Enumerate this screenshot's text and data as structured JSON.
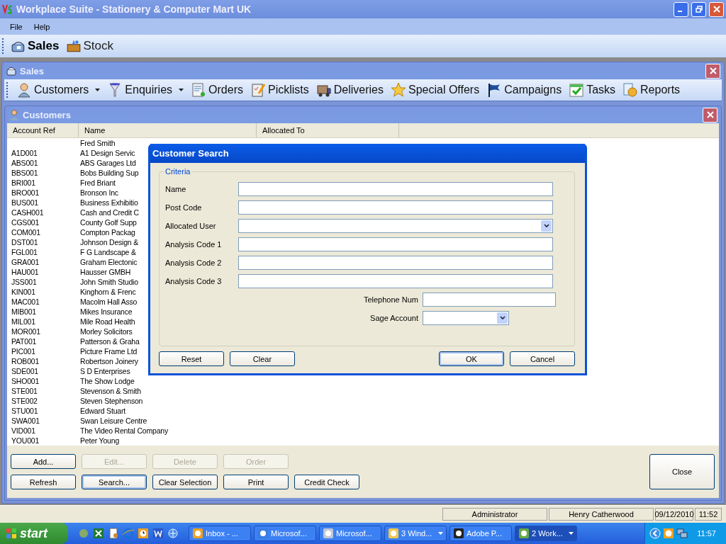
{
  "window": {
    "title": "Workplace Suite - Stationery & Computer Mart UK"
  },
  "menu": [
    "File",
    "Help"
  ],
  "modules": [
    {
      "label": "Sales",
      "selected": true
    },
    {
      "label": "Stock",
      "selected": false
    }
  ],
  "sales_window": {
    "title": "Sales",
    "toolbar": [
      {
        "label": "Customers",
        "dropdown": true
      },
      {
        "label": "Enquiries",
        "dropdown": true
      },
      {
        "label": "Orders",
        "dropdown": false
      },
      {
        "label": "Picklists",
        "dropdown": false
      },
      {
        "label": "Deliveries",
        "dropdown": false
      },
      {
        "label": "Special Offers",
        "dropdown": false
      },
      {
        "label": "Campaigns",
        "dropdown": false
      },
      {
        "label": "Tasks",
        "dropdown": false
      },
      {
        "label": "Reports",
        "dropdown": false
      }
    ]
  },
  "customers_window": {
    "title": "Customers",
    "columns": [
      "Account Ref",
      "Name",
      "Allocated To"
    ],
    "rows": [
      {
        "ref": "",
        "name": "Fred Smith"
      },
      {
        "ref": "A1D001",
        "name": "A1 Design Servic"
      },
      {
        "ref": "ABS001",
        "name": "ABS Garages Ltd"
      },
      {
        "ref": "BBS001",
        "name": "Bobs Building Sup"
      },
      {
        "ref": "BRI001",
        "name": "Fred Briant"
      },
      {
        "ref": "BRO001",
        "name": "Bronson Inc"
      },
      {
        "ref": "BUS001",
        "name": "Business Exhibitio"
      },
      {
        "ref": "CASH001",
        "name": "Cash and Credit C"
      },
      {
        "ref": "CGS001",
        "name": "County Golf Supp"
      },
      {
        "ref": "COM001",
        "name": "Compton Packag"
      },
      {
        "ref": "DST001",
        "name": "Johnson Design &"
      },
      {
        "ref": "FGL001",
        "name": "F G Landscape &"
      },
      {
        "ref": "GRA001",
        "name": "Graham Electonic"
      },
      {
        "ref": "HAU001",
        "name": "Hausser GMBH"
      },
      {
        "ref": "JSS001",
        "name": "John Smith Studio"
      },
      {
        "ref": "KIN001",
        "name": "Kinghorn & Frenc"
      },
      {
        "ref": "MAC001",
        "name": "Macolm Hall Asso"
      },
      {
        "ref": "MIB001",
        "name": "Mikes Insurance"
      },
      {
        "ref": "MIL001",
        "name": "Mile Road Health"
      },
      {
        "ref": "MOR001",
        "name": "Morley Solicitors"
      },
      {
        "ref": "PAT001",
        "name": "Patterson & Graha"
      },
      {
        "ref": "PIC001",
        "name": "Picture Frame Ltd"
      },
      {
        "ref": "ROB001",
        "name": "Robertson Joinery"
      },
      {
        "ref": "SDE001",
        "name": "S D Enterprises"
      },
      {
        "ref": "SHO001",
        "name": "The Show Lodge"
      },
      {
        "ref": "STE001",
        "name": "Stevenson & Smith"
      },
      {
        "ref": "STE002",
        "name": "Steven Stephenson"
      },
      {
        "ref": "STU001",
        "name": "Edward Stuart"
      },
      {
        "ref": "SWA001",
        "name": "Swan Leisure Centre"
      },
      {
        "ref": "VID001",
        "name": "The Video Rental Company"
      },
      {
        "ref": "YOU001",
        "name": "Peter Young"
      }
    ],
    "button_rows": [
      [
        {
          "label": "Add...",
          "disabled": false,
          "focused": false
        },
        {
          "label": "Edit...",
          "disabled": true,
          "focused": false
        },
        {
          "label": "Delete",
          "disabled": true,
          "focused": false
        },
        {
          "label": "Order",
          "disabled": true,
          "focused": false
        }
      ],
      [
        {
          "label": "Refresh",
          "disabled": false,
          "focused": false
        },
        {
          "label": "Search...",
          "disabled": false,
          "focused": true
        },
        {
          "label": "Clear Selection",
          "disabled": false,
          "focused": false
        },
        {
          "label": "Print",
          "disabled": false,
          "focused": false
        },
        {
          "label": "Credit Check",
          "disabled": false,
          "focused": false
        }
      ]
    ],
    "close_button": "Close"
  },
  "dialog": {
    "title": "Customer Search",
    "group": "Criteria",
    "fields": [
      {
        "label": "Name",
        "kind": "text"
      },
      {
        "label": "Post Code",
        "kind": "text"
      },
      {
        "label": "Allocated User",
        "kind": "dropdown"
      },
      {
        "label": "Analysis Code 1",
        "kind": "text"
      },
      {
        "label": "Analysis Code 2",
        "kind": "text"
      },
      {
        "label": "Analysis Code 3",
        "kind": "text"
      }
    ],
    "short_fields": [
      {
        "label": "Telephone Num",
        "kind": "text"
      },
      {
        "label": "Sage Account",
        "kind": "dropdown"
      }
    ],
    "left_buttons": [
      {
        "label": "Reset",
        "focused": false
      },
      {
        "label": "Clear",
        "focused": false
      }
    ],
    "right_buttons": [
      {
        "label": "OK",
        "focused": true
      },
      {
        "label": "Cancel",
        "focused": false
      }
    ]
  },
  "status_bar": [
    "Administrator",
    "Henry Catherwood",
    "09/12/2010",
    "11:52"
  ],
  "taskbar": {
    "start": "start",
    "tasks": [
      {
        "label": "Inbox - ...",
        "selected": false,
        "group": false
      },
      {
        "label": "Microsof...",
        "selected": false,
        "group": false
      },
      {
        "label": "Microsof...",
        "selected": false,
        "group": false
      },
      {
        "label": "3 Wind...",
        "selected": false,
        "group": true
      },
      {
        "label": "Adobe P...",
        "selected": false,
        "group": false
      },
      {
        "label": "2 Work...",
        "selected": true,
        "group": true
      }
    ],
    "clock": "11:57"
  }
}
